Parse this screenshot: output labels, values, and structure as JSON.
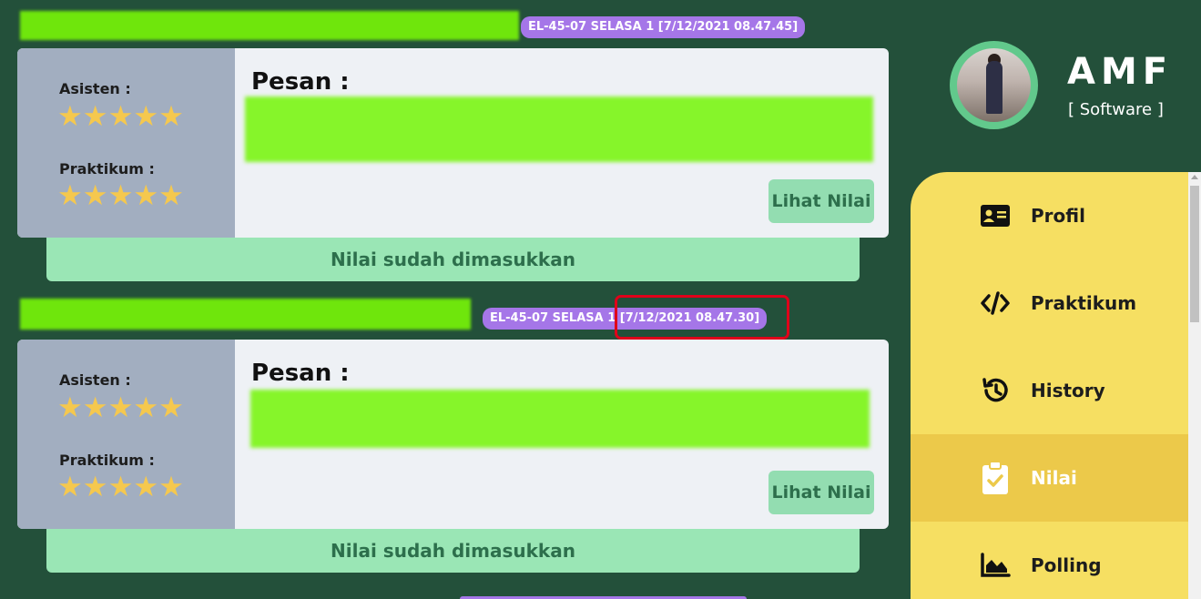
{
  "entries": [
    {
      "tag": "EL-45-07 SELASA 1 [7/12/2021 08.47.45]",
      "asisten_label": "Asisten :",
      "asisten_stars": "★★★★★",
      "asisten_rating": 5,
      "praktikum_label": "Praktikum :",
      "praktikum_stars": "★★★★★",
      "praktikum_rating": 5,
      "pesan_label": "Pesan :",
      "button_label": "Lihat Nilai",
      "status": "Nilai sudah dimasukkan"
    },
    {
      "tag": "EL-45-07 SELASA 1 [7/12/2021 08.47.30]",
      "asisten_label": "Asisten :",
      "asisten_stars": "★★★★★",
      "asisten_rating": 5,
      "praktikum_label": "Praktikum :",
      "praktikum_stars": "★★★★★",
      "praktikum_rating": 5,
      "pesan_label": "Pesan :",
      "button_label": "Lihat Nilai",
      "status": "Nilai sudah dimasukkan"
    }
  ],
  "user": {
    "name": "AMF",
    "role": "[ Software ]"
  },
  "menu": [
    {
      "label": "Profil",
      "icon": "id-card-icon",
      "active": false
    },
    {
      "label": "Praktikum",
      "icon": "code-icon",
      "active": false
    },
    {
      "label": "History",
      "icon": "history-icon",
      "active": false
    },
    {
      "label": "Nilai",
      "icon": "clipboard-check-icon",
      "active": true
    },
    {
      "label": "Polling",
      "icon": "area-chart-icon",
      "active": false
    }
  ],
  "colors": {
    "background": "#23503a",
    "menu": "#f6df62",
    "menu_active": "#ecc94a",
    "tag": "#a576e8",
    "status": "#9ae6b5",
    "stars": "#f5c84e",
    "highlight": "#e0001a"
  }
}
